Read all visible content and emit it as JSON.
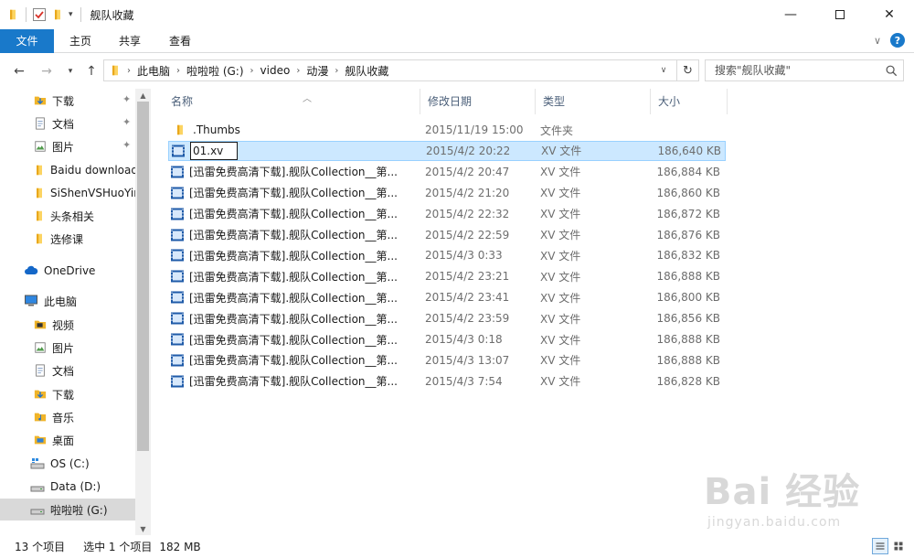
{
  "window": {
    "title": "舰队收藏"
  },
  "ribbon": {
    "tabs": [
      "文件",
      "主页",
      "共享",
      "查看"
    ]
  },
  "address": {
    "crumbs": [
      "此电脑",
      "啦啦啦 (G:)",
      "video",
      "动漫",
      "舰队收藏"
    ]
  },
  "search": {
    "placeholder": "搜索\"舰队收藏\""
  },
  "nav": {
    "quick": [
      {
        "label": "下载",
        "pinned": true
      },
      {
        "label": "文档",
        "pinned": true
      },
      {
        "label": "图片",
        "pinned": true
      },
      {
        "label": "Baidu download"
      },
      {
        "label": "SiShenVSHuoYing"
      },
      {
        "label": "头条相关"
      },
      {
        "label": "选修课"
      }
    ],
    "onedrive": "OneDrive",
    "thispc": "此电脑",
    "pc_items": [
      "视频",
      "图片",
      "文档",
      "下载",
      "音乐",
      "桌面"
    ],
    "drives": [
      "OS (C:)",
      "Data (D:)",
      "啦啦啦 (G:)"
    ]
  },
  "columns": {
    "name": "名称",
    "date": "修改日期",
    "type": "类型",
    "size": "大小"
  },
  "files": [
    {
      "name": ".Thumbs",
      "date": "2015/11/19 15:00",
      "type": "文件夹",
      "size": "",
      "kind": "folder"
    },
    {
      "name": "01.xv",
      "date": "2015/4/2 20:22",
      "type": "XV 文件",
      "size": "186,640 KB",
      "kind": "video",
      "selected": true,
      "renaming": true
    },
    {
      "name": "[迅雷免费高清下载].舰队Collection__第...",
      "date": "2015/4/2 20:47",
      "type": "XV 文件",
      "size": "186,884 KB",
      "kind": "video"
    },
    {
      "name": "[迅雷免费高清下载].舰队Collection__第...",
      "date": "2015/4/2 21:20",
      "type": "XV 文件",
      "size": "186,860 KB",
      "kind": "video"
    },
    {
      "name": "[迅雷免费高清下载].舰队Collection__第...",
      "date": "2015/4/2 22:32",
      "type": "XV 文件",
      "size": "186,872 KB",
      "kind": "video"
    },
    {
      "name": "[迅雷免费高清下载].舰队Collection__第...",
      "date": "2015/4/2 22:59",
      "type": "XV 文件",
      "size": "186,876 KB",
      "kind": "video"
    },
    {
      "name": "[迅雷免费高清下载].舰队Collection__第...",
      "date": "2015/4/3 0:33",
      "type": "XV 文件",
      "size": "186,832 KB",
      "kind": "video"
    },
    {
      "name": "[迅雷免费高清下载].舰队Collection__第...",
      "date": "2015/4/2 23:21",
      "type": "XV 文件",
      "size": "186,888 KB",
      "kind": "video"
    },
    {
      "name": "[迅雷免费高清下载].舰队Collection__第...",
      "date": "2015/4/2 23:41",
      "type": "XV 文件",
      "size": "186,800 KB",
      "kind": "video"
    },
    {
      "name": "[迅雷免费高清下载].舰队Collection__第...",
      "date": "2015/4/2 23:59",
      "type": "XV 文件",
      "size": "186,856 KB",
      "kind": "video"
    },
    {
      "name": "[迅雷免费高清下载].舰队Collection__第...",
      "date": "2015/4/3 0:18",
      "type": "XV 文件",
      "size": "186,888 KB",
      "kind": "video"
    },
    {
      "name": "[迅雷免费高清下载].舰队Collection__第...",
      "date": "2015/4/3 13:07",
      "type": "XV 文件",
      "size": "186,888 KB",
      "kind": "video"
    },
    {
      "name": "[迅雷免费高清下载].舰队Collection__第...",
      "date": "2015/4/3 7:54",
      "type": "XV 文件",
      "size": "186,828 KB",
      "kind": "video"
    }
  ],
  "status": {
    "count": "13 个项目",
    "selection": "选中 1 个项目",
    "selsize": "182 MB"
  },
  "watermark": {
    "brand": "Bai 经验",
    "url": "jingyan.baidu.com"
  },
  "colors": {
    "accent": "#1979ca",
    "selection": "#cce8ff",
    "folder": "#f7c948"
  }
}
